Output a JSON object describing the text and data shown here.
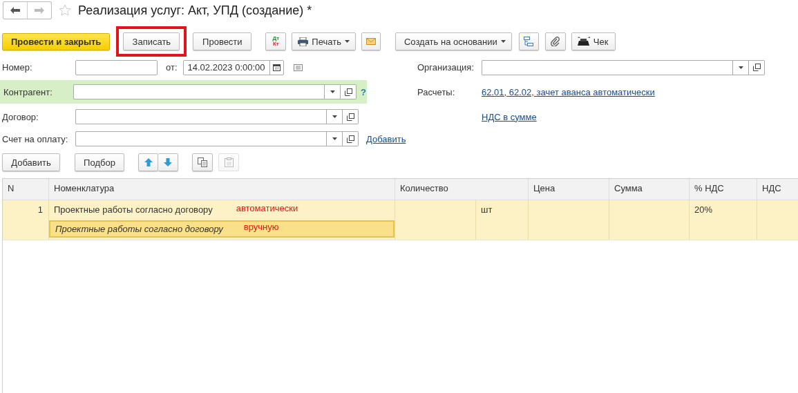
{
  "window": {
    "title": "Реализация услуг: Акт, УПД (создание) *"
  },
  "toolbar": {
    "post_close": "Провести и закрыть",
    "save": {
      "label": "Записать",
      "highlighted": true
    },
    "post": "Провести",
    "dt_label": "Дт",
    "kt_label": "Кт",
    "print": "Печать",
    "create_based": "Создать на основании",
    "receipt": "Чек"
  },
  "form": {
    "number_label": "Номер:",
    "date_label": "от:",
    "date": "14.02.2023  0:00:00",
    "counterparty": {
      "label": "Контрагент:",
      "help": "?",
      "highlighted": true
    },
    "contract_label": "Договор:",
    "invoice_label": "Счет на оплату:",
    "invoice_add": "Добавить",
    "organization_label": "Организация:",
    "settlements_label": "Расчеты:",
    "settlements_link": "62.01, 62.02, зачет аванса автоматически",
    "vat_link": "НДС в сумме"
  },
  "table_toolbar": {
    "add": "Добавить",
    "pick": "Подбор",
    "paste_disabled": true
  },
  "table": {
    "columns": [
      "N",
      "Номенклатура",
      "Количество",
      "Цена",
      "Сумма",
      "% НДС",
      "НДС"
    ],
    "rows": [
      {
        "n": "1",
        "item": "Проектные работы согласно договору",
        "item_note": "автоматически",
        "content": "Проектные работы согласно договору",
        "content_note": "вручную",
        "unit": "шт",
        "vat_rate": "20%",
        "selected": true
      }
    ]
  }
}
